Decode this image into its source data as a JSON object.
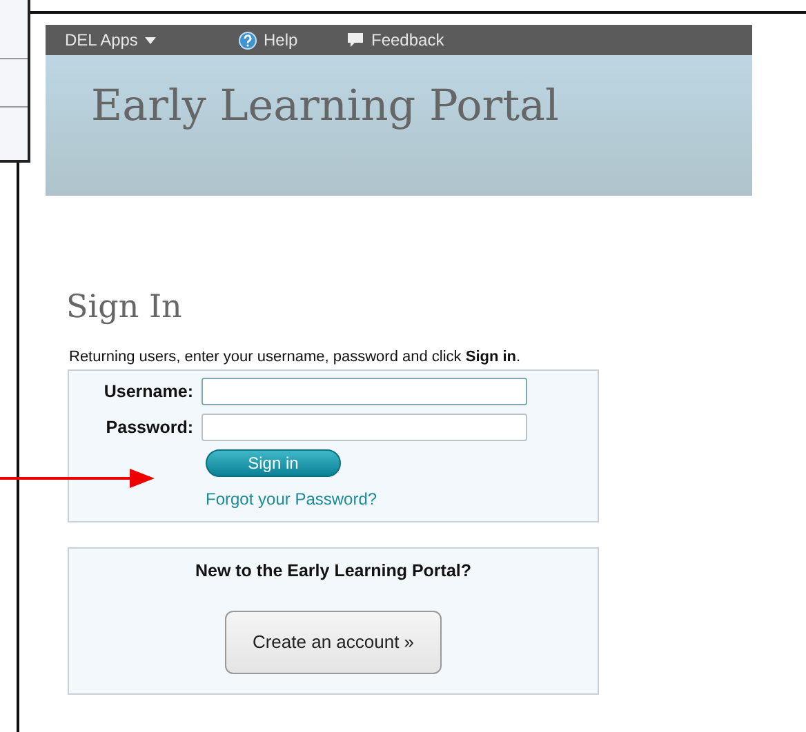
{
  "nav": [
    {
      "label": "DEL Apps",
      "kind": "dropdown"
    },
    {
      "label": "Help",
      "kind": "help"
    },
    {
      "label": "Feedback",
      "kind": "feedback"
    }
  ],
  "banner": {
    "title": "Early Learning Portal"
  },
  "sign_in": {
    "heading": "Sign In",
    "instructions": "Returning users, enter your username, password and click **Sign in**.",
    "fields": [
      {
        "label": "Username:",
        "focused": true
      },
      {
        "label": "Password:",
        "focused": false
      }
    ],
    "button": "Sign in",
    "forgot_link": "Forgot your Password?"
  },
  "register": {
    "prompt": "New to the Early Learning Portal?",
    "button": "Create an account »"
  }
}
